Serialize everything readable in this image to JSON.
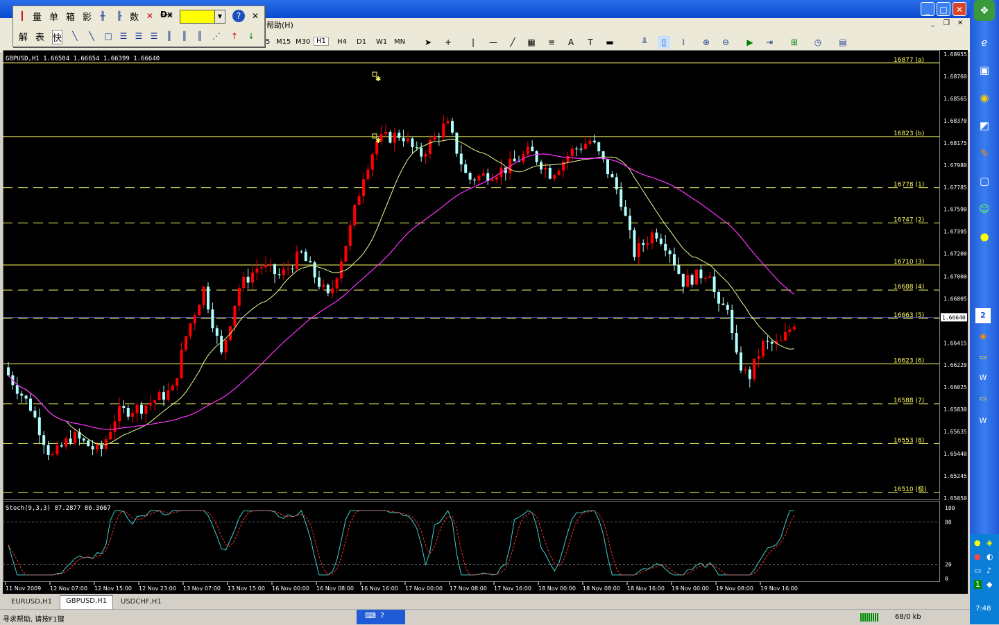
{
  "window": {
    "minimize": "_",
    "maximize": "□",
    "close": "✕"
  },
  "mdi_controls": {
    "minimize": "_",
    "restore": "❐",
    "close": "✕"
  },
  "menu": {
    "help": "帮助(H)"
  },
  "timeframes": [
    "M15",
    "M30",
    "H1",
    "H4",
    "D1",
    "W1",
    "MN"
  ],
  "timeframes_cut": "5",
  "float_toolbar": {
    "row1": [
      "量",
      "单",
      "箱",
      "影",
      "数"
    ],
    "row2": [
      "解",
      "表",
      "快"
    ],
    "dx": "Dx",
    "help_icon": "?",
    "close_icon": "✕"
  },
  "chart": {
    "header": "GBPUSD,H1  1.66504 1.66654 1.66399 1.66640",
    "current_price": "1.66640",
    "price_ticks": [
      "1.68955",
      "1.68760",
      "1.68565",
      "1.68370",
      "1.68175",
      "1.67980",
      "1.67785",
      "1.67590",
      "1.67395",
      "1.67200",
      "1.67000",
      "1.66805",
      "1.66640",
      "1.66415",
      "1.66220",
      "1.66025",
      "1.65830",
      "1.65635",
      "1.65440",
      "1.65245",
      "1.65050"
    ],
    "levels": [
      {
        "label": "16877 (a)",
        "price": 1.68877,
        "dashed": false
      },
      {
        "label": "16823 (b)",
        "price": 1.6823,
        "dashed": false
      },
      {
        "label": "16778 (1)",
        "price": 1.6778,
        "dashed": true
      },
      {
        "label": "16747 (2)",
        "price": 1.6747,
        "dashed": true
      },
      {
        "label": "16710 (3)",
        "price": 1.671,
        "dashed": false
      },
      {
        "label": "16688 (4)",
        "price": 1.6688,
        "dashed": true
      },
      {
        "label": "16663 (5)",
        "price": 1.6663,
        "dashed": true
      },
      {
        "label": "16623 (6)",
        "price": 1.6623,
        "dashed": false
      },
      {
        "label": "16588 (7)",
        "price": 1.6588,
        "dashed": true
      },
      {
        "label": "16553 (8)",
        "price": 1.6553,
        "dashed": true
      },
      {
        "label": "16510 (极)",
        "price": 1.651,
        "dashed": true
      }
    ],
    "stoch_label": "Stoch(9,3,3) 87.2877 86.3667",
    "stoch_ticks": [
      "100",
      "80",
      "20",
      "0"
    ],
    "time_labels": [
      "11 Nov 2009",
      "12 Nov 07:00",
      "12 Nov 15:00",
      "12 Nov 23:00",
      "13 Nov 07:00",
      "13 Nov 15:00",
      "16 Nov 00:00",
      "16 Nov 08:00",
      "16 Nov 16:00",
      "17 Nov 00:00",
      "17 Nov 08:00",
      "17 Nov 16:00",
      "18 Nov 00:00",
      "18 Nov 08:00",
      "18 Nov 16:00",
      "19 Nov 00:00",
      "19 Nov 08:00",
      "19 Nov 16:00"
    ]
  },
  "tabs": [
    "EURUSD,H1",
    "GBPUSD,H1",
    "USDCHF,H1"
  ],
  "status": {
    "help": "寻求帮助, 请按F1键",
    "traffic": "68/0 kb"
  },
  "taskbar": {
    "clock": "7:48"
  },
  "colors": {
    "bull": "#ff0000",
    "bear": "#b0ffff",
    "fast_ma": "#e6ff99",
    "slow_ma": "#ff33ff",
    "level": "#ffff66",
    "stoch_main": "#40d0d0",
    "stoch_signal": "#ff3030"
  }
}
